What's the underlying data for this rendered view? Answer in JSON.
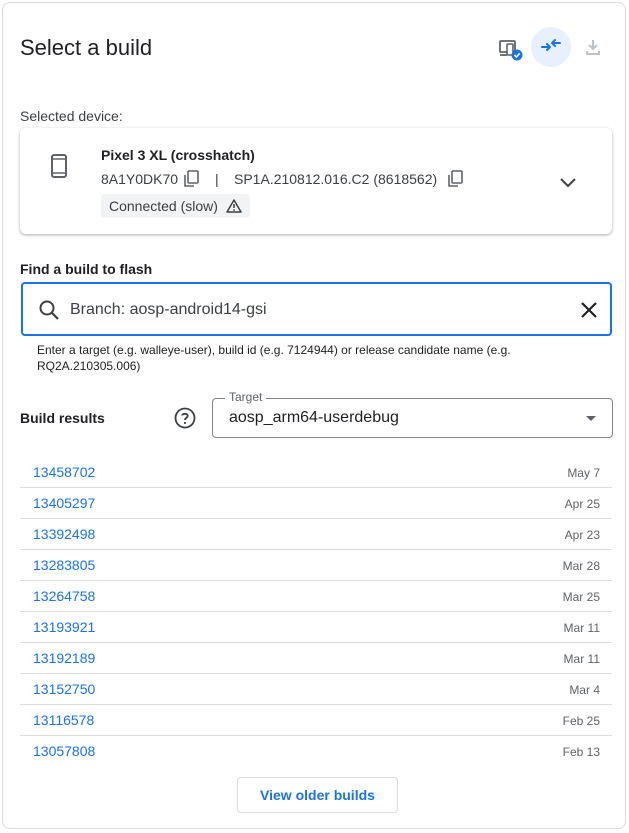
{
  "header": {
    "title": "Select a build",
    "icons": [
      "devices-icon",
      "connect-arrows-icon",
      "download-icon"
    ]
  },
  "device": {
    "section_label": "Selected device:",
    "name": "Pixel 3 XL (crosshatch)",
    "serial": "8A1Y0DK70",
    "separator": "|",
    "build": "SP1A.210812.016.C2 (8618562)",
    "status": "Connected (slow)"
  },
  "find": {
    "label": "Find a build to flash",
    "search_value": "Branch: aosp-android14-gsi",
    "hint": "Enter a target (e.g. walleye-user), build id (e.g. 7124944) or release candidate name (e.g. RQ2A.210305.006)"
  },
  "results": {
    "label": "Build results",
    "target_legend": "Target",
    "target_value": "aosp_arm64-userdebug",
    "builds": [
      {
        "id": "13458702",
        "date": "May 7"
      },
      {
        "id": "13405297",
        "date": "Apr 25"
      },
      {
        "id": "13392498",
        "date": "Apr 23"
      },
      {
        "id": "13283805",
        "date": "Mar 28"
      },
      {
        "id": "13264758",
        "date": "Mar 25"
      },
      {
        "id": "13193921",
        "date": "Mar 11"
      },
      {
        "id": "13192189",
        "date": "Mar 11"
      },
      {
        "id": "13152750",
        "date": "Mar 4"
      },
      {
        "id": "13116578",
        "date": "Feb 25"
      },
      {
        "id": "13057808",
        "date": "Feb 13"
      }
    ],
    "older_button": "View older builds"
  },
  "colors": {
    "accent": "#1a73e8",
    "accent_bg": "#e8f0fe",
    "text": "#202124",
    "muted": "#5f6368",
    "border": "#dadce0"
  }
}
